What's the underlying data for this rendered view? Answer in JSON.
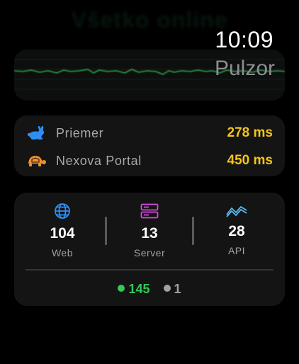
{
  "header": {
    "blurred_title": "Všetko online",
    "time": "10:09",
    "app_name": "Pulzor"
  },
  "response_times": [
    {
      "name": "Priemer",
      "value": "278 ms",
      "icon": "rabbit-icon",
      "icon_color": "#2f8ef5"
    },
    {
      "name": "Nexova Portal",
      "value": "450 ms",
      "icon": "turtle-icon",
      "icon_color": "#f0902a"
    }
  ],
  "monitor_types": [
    {
      "label": "Web",
      "count": "104",
      "icon": "globe-icon",
      "icon_color": "#2f8ef5"
    },
    {
      "label": "Server",
      "count": "13",
      "icon": "server-icon",
      "icon_color": "#d24be0"
    },
    {
      "label": "API",
      "count": "28",
      "icon": "pulse-wave-icon",
      "icon_color": "#5ab8f0"
    }
  ],
  "status_counts": {
    "up": "145",
    "down": "1",
    "up_color": "#34c759",
    "down_color": "#a0a0a6"
  },
  "colors": {
    "background": "#000000",
    "card": "#141414",
    "accent_yellow": "#f5c518",
    "graph_green": "#2ea84a"
  }
}
